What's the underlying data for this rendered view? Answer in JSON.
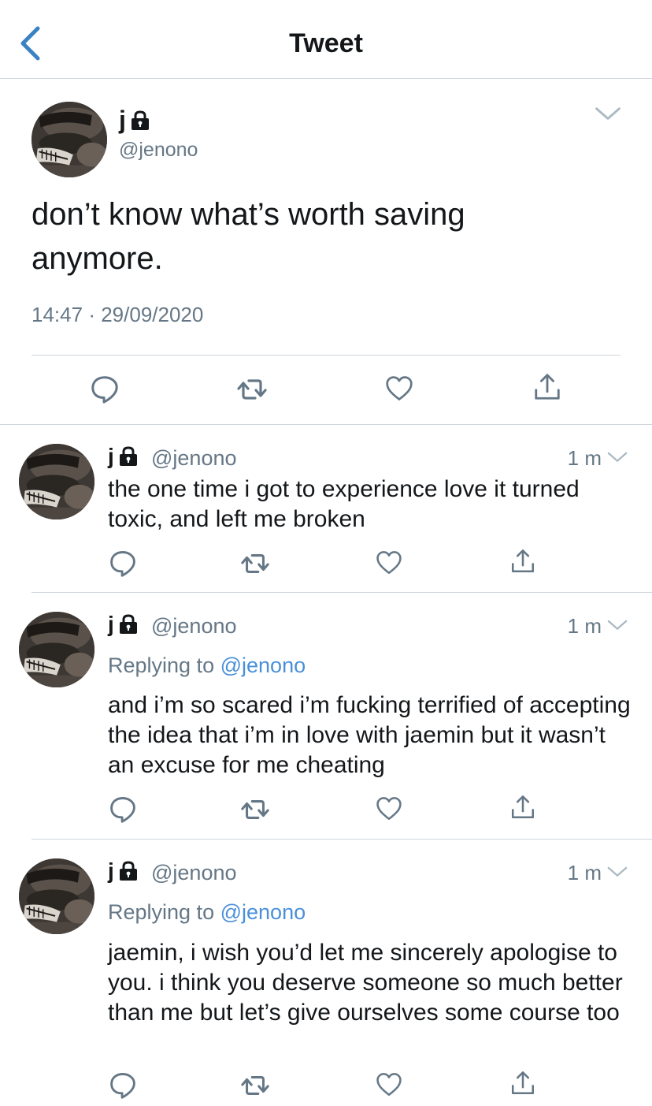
{
  "header": {
    "title": "Tweet"
  },
  "main_tweet": {
    "name": "j",
    "handle": "@jenono",
    "text": "don’t know what’s worth saving anymore.",
    "time": "14:47",
    "date": "29/09/2020",
    "separator": "·"
  },
  "replies": [
    {
      "name": "j",
      "handle": "@jenono",
      "time": "1 m",
      "text": "the one time i got to experience love it turned toxic, and left me broken"
    },
    {
      "name": "j",
      "handle": "@jenono",
      "time": "1 m",
      "replying_prefix": "Replying to",
      "replying_to": "@jenono",
      "text": "and i’m so scared i’m fucking terrified of accepting the idea that i’m in love with jaemin but it wasn’t an excuse for me cheating"
    },
    {
      "name": "j",
      "handle": "@jenono",
      "time": "1 m",
      "replying_prefix": "Replying to",
      "replying_to": "@jenono",
      "text": "jaemin, i wish you’d let me sincerely apologise to you. i think you deserve someone so much better than me but let’s give ourselves some course too"
    }
  ],
  "colors": {
    "accent": "#4a90d9",
    "icon_gray": "#657786",
    "divider": "#cfd6dc"
  },
  "icons": [
    "back-icon",
    "lock-icon",
    "chevron-down-icon",
    "reply-icon",
    "retweet-icon",
    "like-icon",
    "share-icon"
  ]
}
